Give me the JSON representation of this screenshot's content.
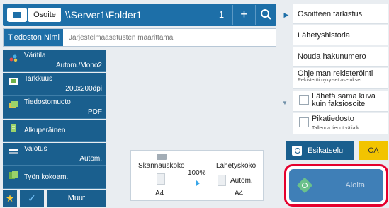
{
  "address": {
    "label": "Osoite",
    "path": "\\\\Server1\\Folder1",
    "count": "1",
    "plus": "+"
  },
  "filename": {
    "label": "Tiedoston Nimi",
    "placeholder": "Järjestelmäasetusten määrittämä"
  },
  "settings": [
    {
      "name": "Väritila",
      "value": "Autom./Mono2"
    },
    {
      "name": "Tarkkuus",
      "value": "200x200dpi"
    },
    {
      "name": "Tiedostomuoto",
      "value": "PDF"
    },
    {
      "name": "Alkuperäinen",
      "value": ""
    },
    {
      "name": "Valotus",
      "value": "Autom."
    },
    {
      "name": "Työn kokoam.",
      "value": ""
    }
  ],
  "bottom": {
    "star": "★",
    "check": "✓",
    "more": "Muut"
  },
  "summary": {
    "scan_label": "Skannauskoko",
    "send_label": "Lähetyskoko",
    "percent": "100%",
    "send_value": "Autom.",
    "scan_size": "A4",
    "send_size": "A4"
  },
  "right": {
    "collapse": "▶",
    "address_check": "Osoitteen tarkistus",
    "history": "Lähetyshistoria",
    "recall": "Nouda hakunumero",
    "program": "Ohjelman rekisteröinti",
    "program_sub": "Rekisteröi nykyiset asetukset",
    "same_image": "Lähetä sama kuva kuin faksiosoite",
    "quick_file": "Pikatiedosto",
    "quick_file_sub": "Tallenna tiedot väliaik.",
    "down": "▼"
  },
  "actions": {
    "preview": "Esikatselu",
    "ca": "CA",
    "start": "Aloita"
  },
  "colors": {
    "accent": "#1d6fa8",
    "start": "#3f7fb7",
    "start_border": "#e5002d",
    "ca": "#f2c400"
  }
}
